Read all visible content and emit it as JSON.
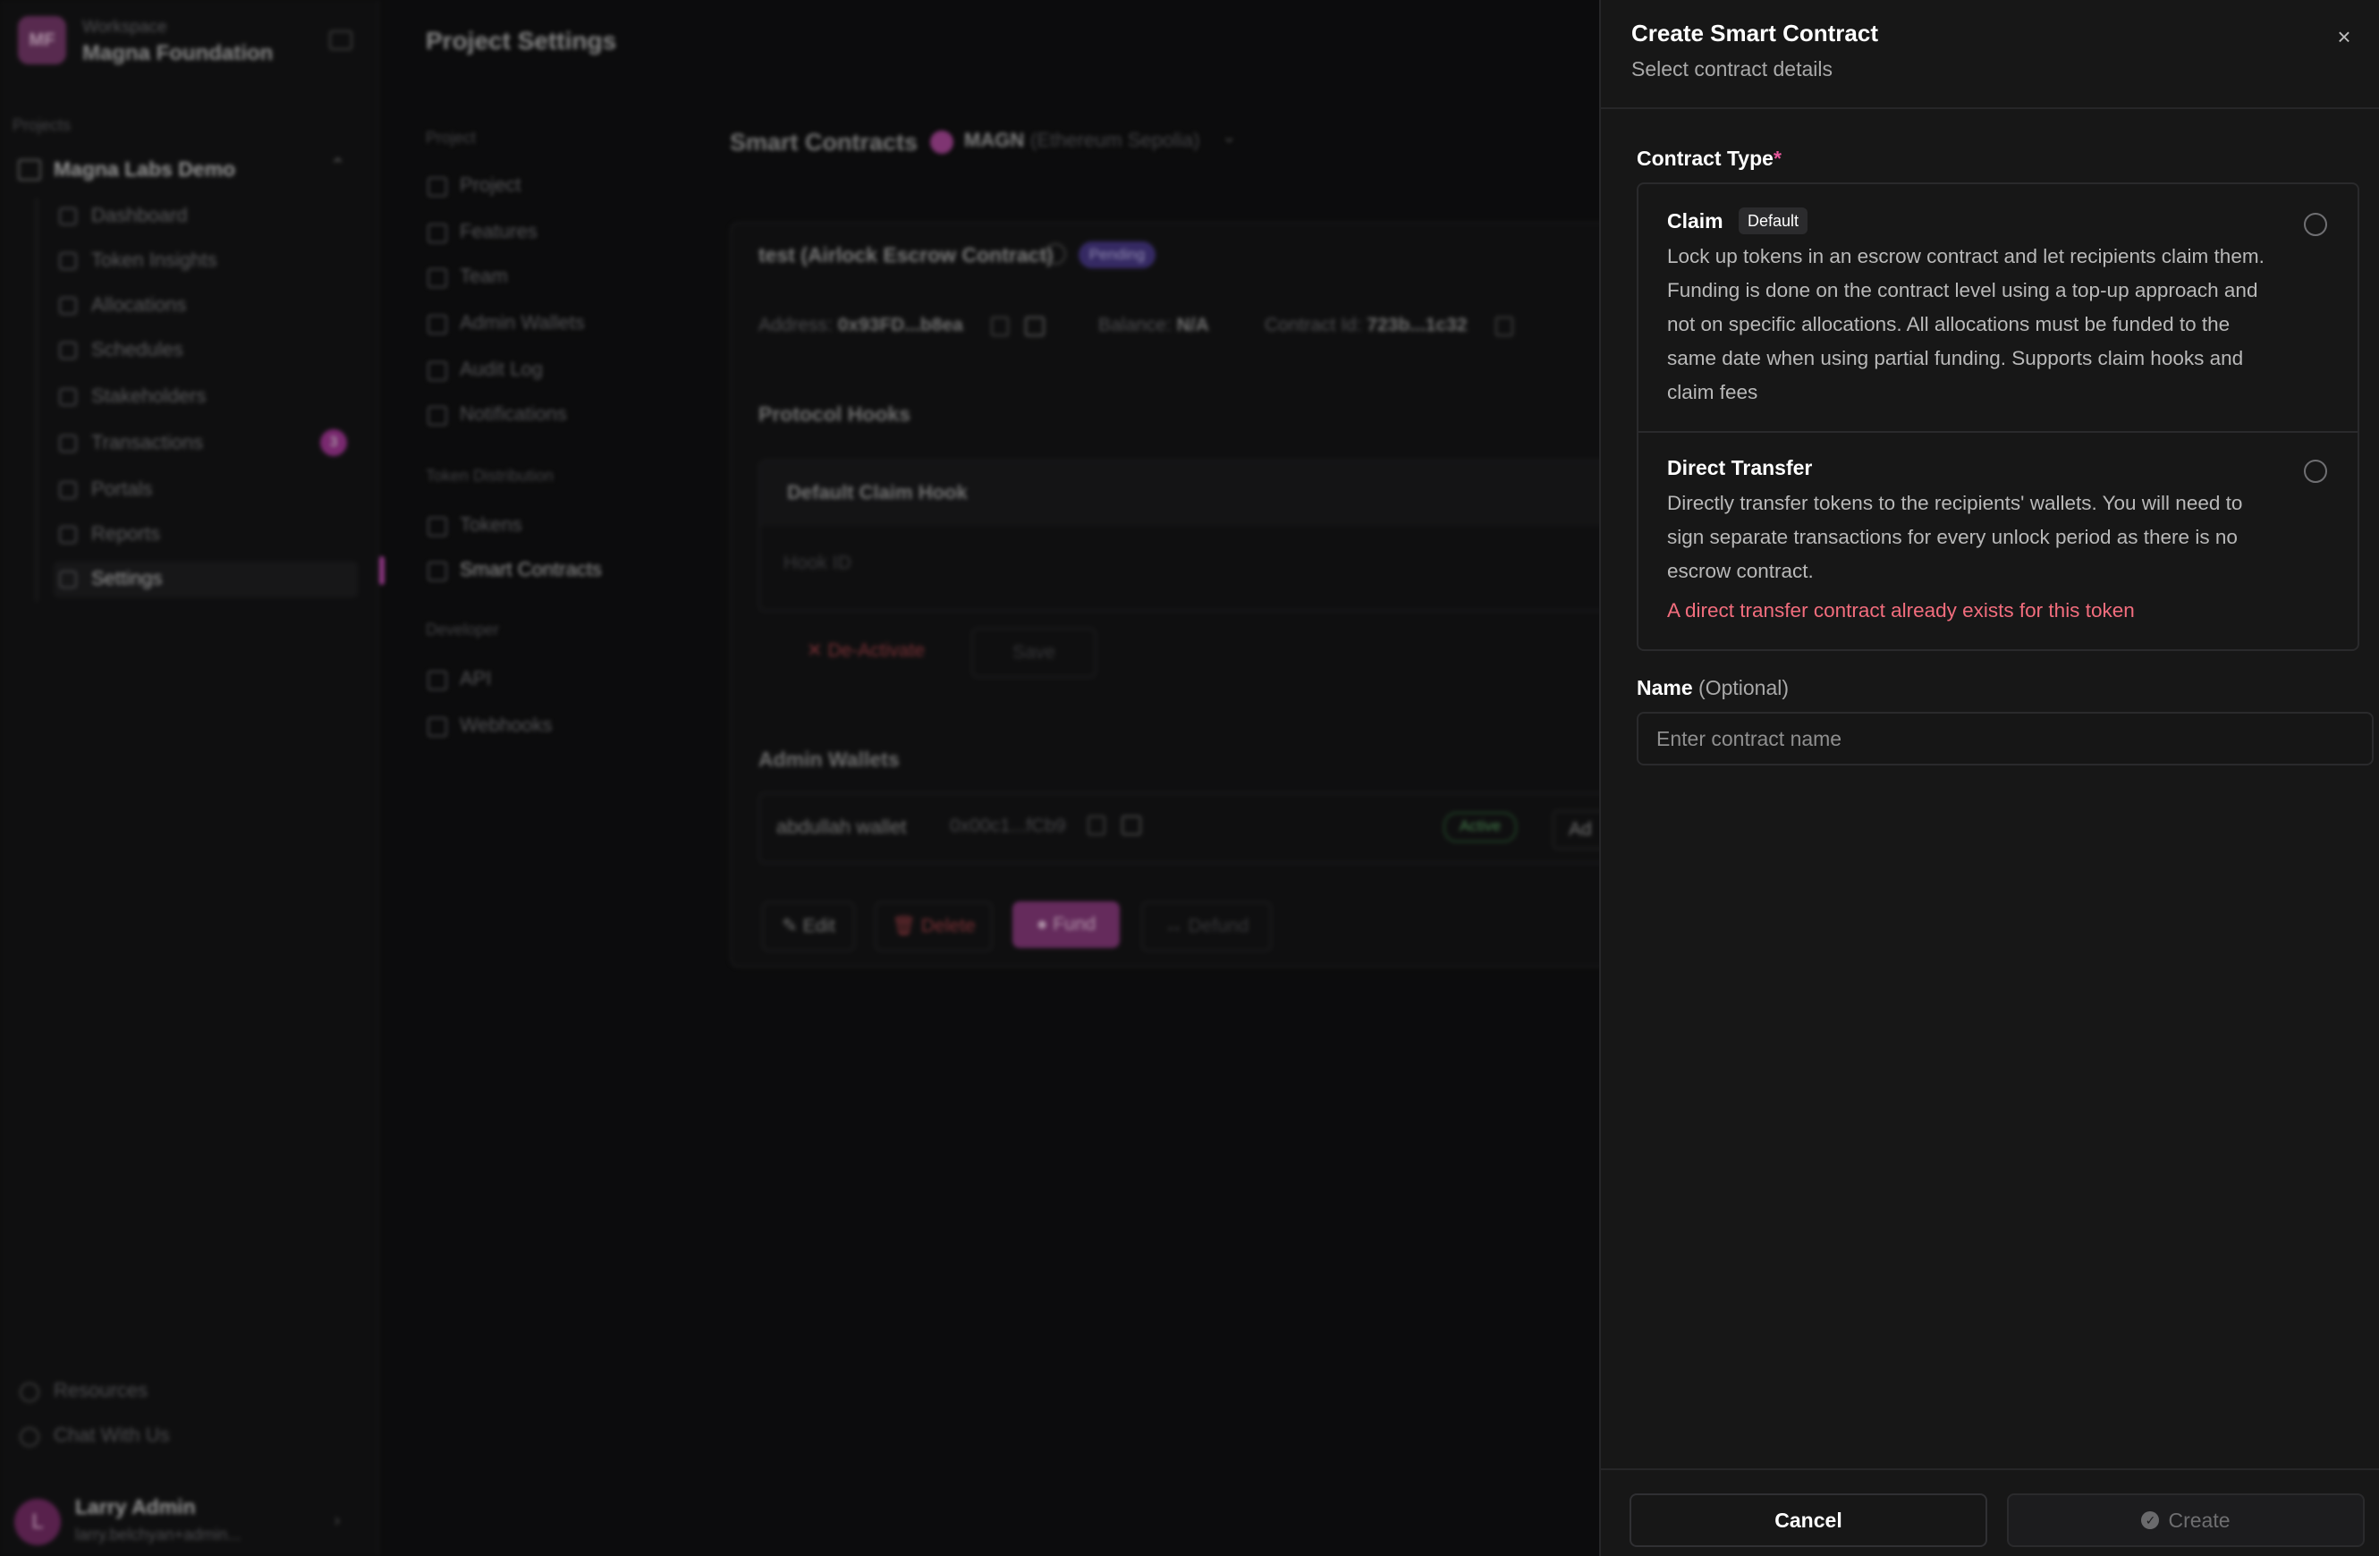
{
  "sidebar": {
    "workspace_small": "Workspace",
    "workspace_name": "Magna Foundation",
    "logo_text": "MF",
    "projects_label": "Projects",
    "project_name": "Magna Labs Demo",
    "items": [
      {
        "label": "Dashboard"
      },
      {
        "label": "Token Insights"
      },
      {
        "label": "Allocations"
      },
      {
        "label": "Schedules"
      },
      {
        "label": "Stakeholders"
      },
      {
        "label": "Transactions",
        "badge": "3"
      },
      {
        "label": "Portals"
      },
      {
        "label": "Reports"
      },
      {
        "label": "Settings"
      }
    ],
    "resources": "Resources",
    "chat": "Chat With Us",
    "user_initial": "L",
    "user_name": "Larry Admin",
    "user_email": "larry.belchyan+admin..."
  },
  "settings_nav": {
    "title": "Project Settings",
    "group_project": "Project",
    "project_items": [
      "Project",
      "Features",
      "Team",
      "Admin Wallets",
      "Audit Log",
      "Notifications"
    ],
    "group_distribution": "Token Distribution",
    "distribution_items": [
      "Tokens",
      "Smart Contracts"
    ],
    "group_developer": "Developer",
    "developer_items": [
      "API",
      "Webhooks"
    ]
  },
  "main": {
    "title": "Smart Contracts",
    "token": "MAGN",
    "network": "(Ethereum Sepolia)",
    "contract_title": "test (Airlock Escrow Contract)",
    "status": "Pending",
    "address_label": "Address:",
    "address": "0x93FD...b8ea",
    "balance_label": "Balance:",
    "balance": "N/A",
    "contract_id_label": "Contract Id:",
    "contract_id": "723b...1c32",
    "hooks_title": "Protocol Hooks",
    "hook_name": "Default Claim Hook",
    "hook_id_placeholder": "Hook ID",
    "deactivate": "De-Activate",
    "save": "Save",
    "admin_wallets_title": "Admin Wallets",
    "wallet_name": "abdullah wallet",
    "wallet_addr": "0x00c1...fCb9",
    "wallet_status": "Active",
    "wallet_extra": "Ad",
    "edit": "Edit",
    "delete": "Delete",
    "fund": "Fund",
    "defund": "Defund"
  },
  "drawer": {
    "title": "Create Smart Contract",
    "subtitle": "Select contract details",
    "close_icon": "×",
    "contract_type_label": "Contract Type",
    "required_mark": "*",
    "options": [
      {
        "title": "Claim",
        "badge": "Default",
        "description": "Lock up tokens in an escrow contract and let recipients claim them. Funding is done on the contract level using a top-up approach and not on specific allocations. All allocations must be funded to the same date when using partial funding. Supports claim hooks and claim fees"
      },
      {
        "title": "Direct Transfer",
        "description": "Directly transfer tokens to the recipients' wallets. You will need to sign separate transactions for every unlock period as there is no escrow contract.",
        "warning": "A direct transfer contract already exists for this token"
      }
    ],
    "name_label": "Name",
    "name_optional": "(Optional)",
    "name_value": "",
    "name_placeholder": "Enter contract name",
    "cancel": "Cancel",
    "create": "Create"
  },
  "colors": {
    "accent": "#c14ab0",
    "warning": "#f26d7d",
    "required": "#e5579a"
  }
}
